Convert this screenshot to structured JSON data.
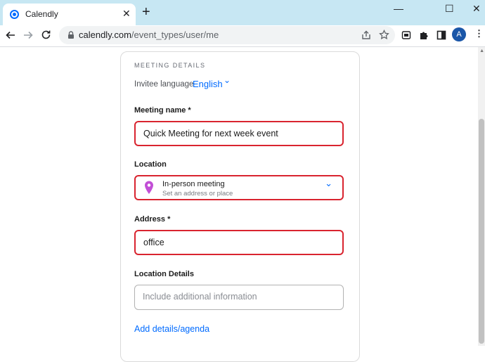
{
  "browser": {
    "tab_title": "Calendly",
    "tab_close": "✕",
    "new_tab": "+",
    "url_host": "calendly.com",
    "url_path": "/event_types/user/me",
    "avatar_letter": "A",
    "win_minimize": "—",
    "win_maximize": "☐",
    "win_close": "✕",
    "chevron": "⌄",
    "icons": {
      "back": "arrow-left-icon",
      "forward": "arrow-right-icon",
      "reload": "reload-icon",
      "lock": "lock-icon",
      "share": "share-icon",
      "bookmark": "star-icon",
      "extensions": "puzzle-icon"
    }
  },
  "form": {
    "section_title": "MEETING DETAILS",
    "invitee_language_label": "Invitee language",
    "invitee_language_value": "English",
    "meeting_name_label": "Meeting name *",
    "meeting_name_value": "Quick Meeting for next week event",
    "location_label": "Location",
    "location_title": "In-person meeting",
    "location_subtitle": "Set an address or place",
    "address_label": "Address *",
    "address_value": "office",
    "location_details_label": "Location Details",
    "location_details_placeholder": "Include additional information",
    "add_details_link": "Add details/agenda"
  },
  "colors": {
    "accent": "#006bff",
    "highlight": "#d9242f",
    "pin": "#c24fd6",
    "tabbar": "#c7e7f3"
  }
}
